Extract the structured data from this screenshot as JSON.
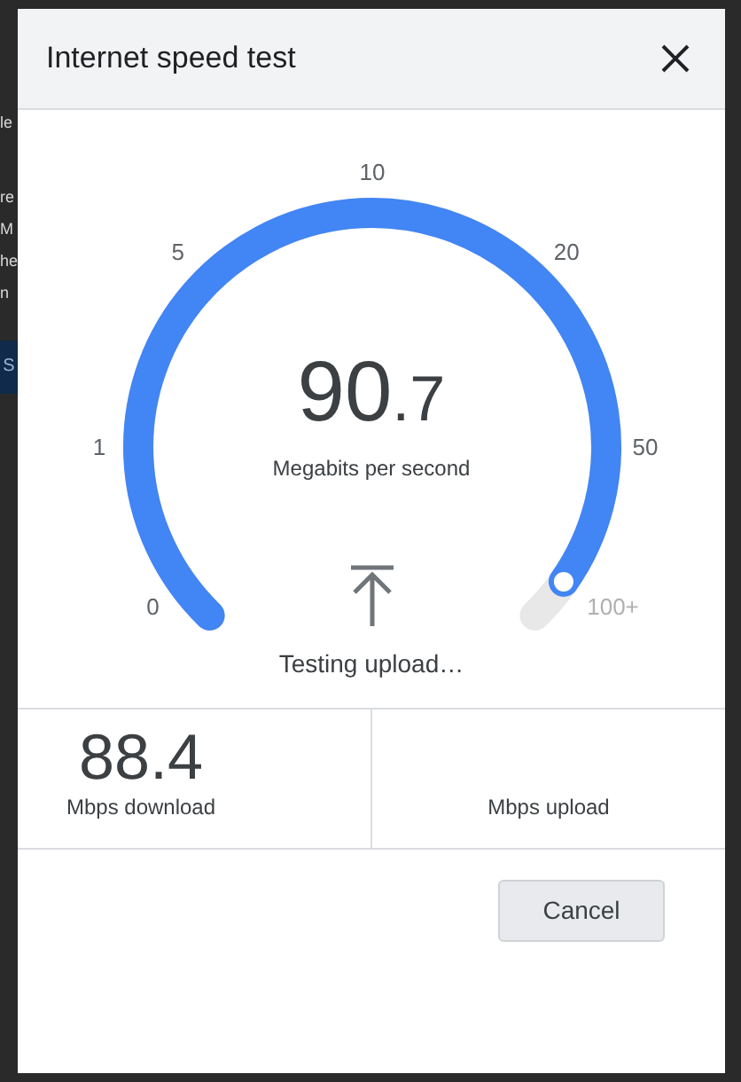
{
  "background": {
    "fragments": [
      "le",
      "re",
      "M",
      "he",
      "n"
    ],
    "button": "S"
  },
  "dialog": {
    "title": "Internet speed test"
  },
  "gauge": {
    "level": 0.96,
    "scale": [
      "0",
      "1",
      "5",
      "10",
      "20",
      "50",
      "100+"
    ],
    "value_whole": "90",
    "value_fraction": ".7",
    "unit": "Megabits per second",
    "status": "Testing upload…"
  },
  "results": [
    {
      "value": "88.4",
      "label": "Mbps download"
    },
    {
      "label": "Mbps upload"
    }
  ],
  "buttons": [
    "Cancel"
  ]
}
